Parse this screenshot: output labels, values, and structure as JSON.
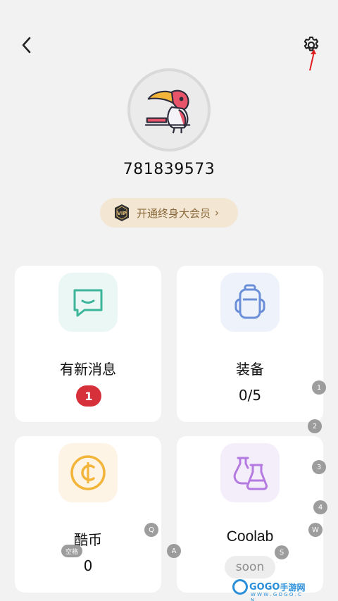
{
  "header": {
    "back_icon": "chevron-left-icon",
    "settings_icon": "gear-icon"
  },
  "profile": {
    "user_id": "781839573",
    "vip_badge_text": "VIP",
    "vip_label": "开通终身大会员",
    "vip_chevron": "›"
  },
  "cards": {
    "messages": {
      "title": "有新消息",
      "badge": "1",
      "icon": "message-icon"
    },
    "equipment": {
      "title": "装备",
      "value": "0/5",
      "icon": "backpack-icon"
    },
    "coins": {
      "title": "酷币",
      "value": "0",
      "icon": "coin-icon"
    },
    "coolab": {
      "title": "Coolab",
      "status": "soon",
      "icon": "flask-icon"
    }
  },
  "keyboard_hints": {
    "k1": "1",
    "k2": "2",
    "k3": "3",
    "k4": "4",
    "kq": "Q",
    "kw": "W",
    "ka": "A",
    "ks": "S",
    "space": "空格"
  },
  "watermark": {
    "brand": "GOGO",
    "cn": "手游网",
    "url": "W W W . G O G O . C N"
  },
  "colors": {
    "background": "#f2f2f2",
    "card": "#ffffff",
    "vip_bg": "#f3e6d2",
    "vip_text": "#8a6a3c",
    "badge_red": "#d6303b",
    "message_tile": "#eaf7f4",
    "backpack_tile": "#eef2fb",
    "coin_tile": "#fdf4e6",
    "flask_tile": "#f4eefb"
  }
}
